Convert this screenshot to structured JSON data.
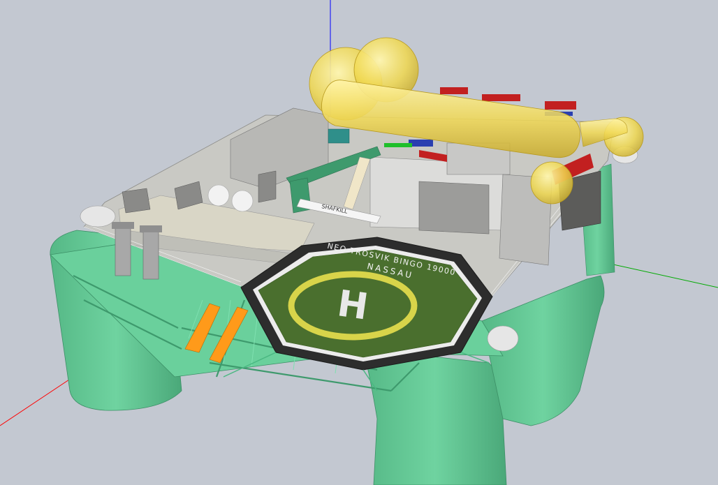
{
  "viewer": {
    "background": "#c3c8d1",
    "axes": {
      "x_color": "#ff0000",
      "y_color": "#00aa00",
      "z_color": "#0000ff"
    }
  },
  "model": {
    "hull_color": "#66cc99",
    "deck_color": "#d8d8d0",
    "tank_color": "#f2de5a",
    "helideck": {
      "surface_color": "#4a6f2e",
      "rim_color": "#333333",
      "circle_color": "#d8d44a",
      "marker": "H",
      "text_line_1": "NEO TROSVIK BINGO 19000",
      "text_line_2": "NASSAU"
    },
    "crane_label": "SHAFKILL"
  }
}
